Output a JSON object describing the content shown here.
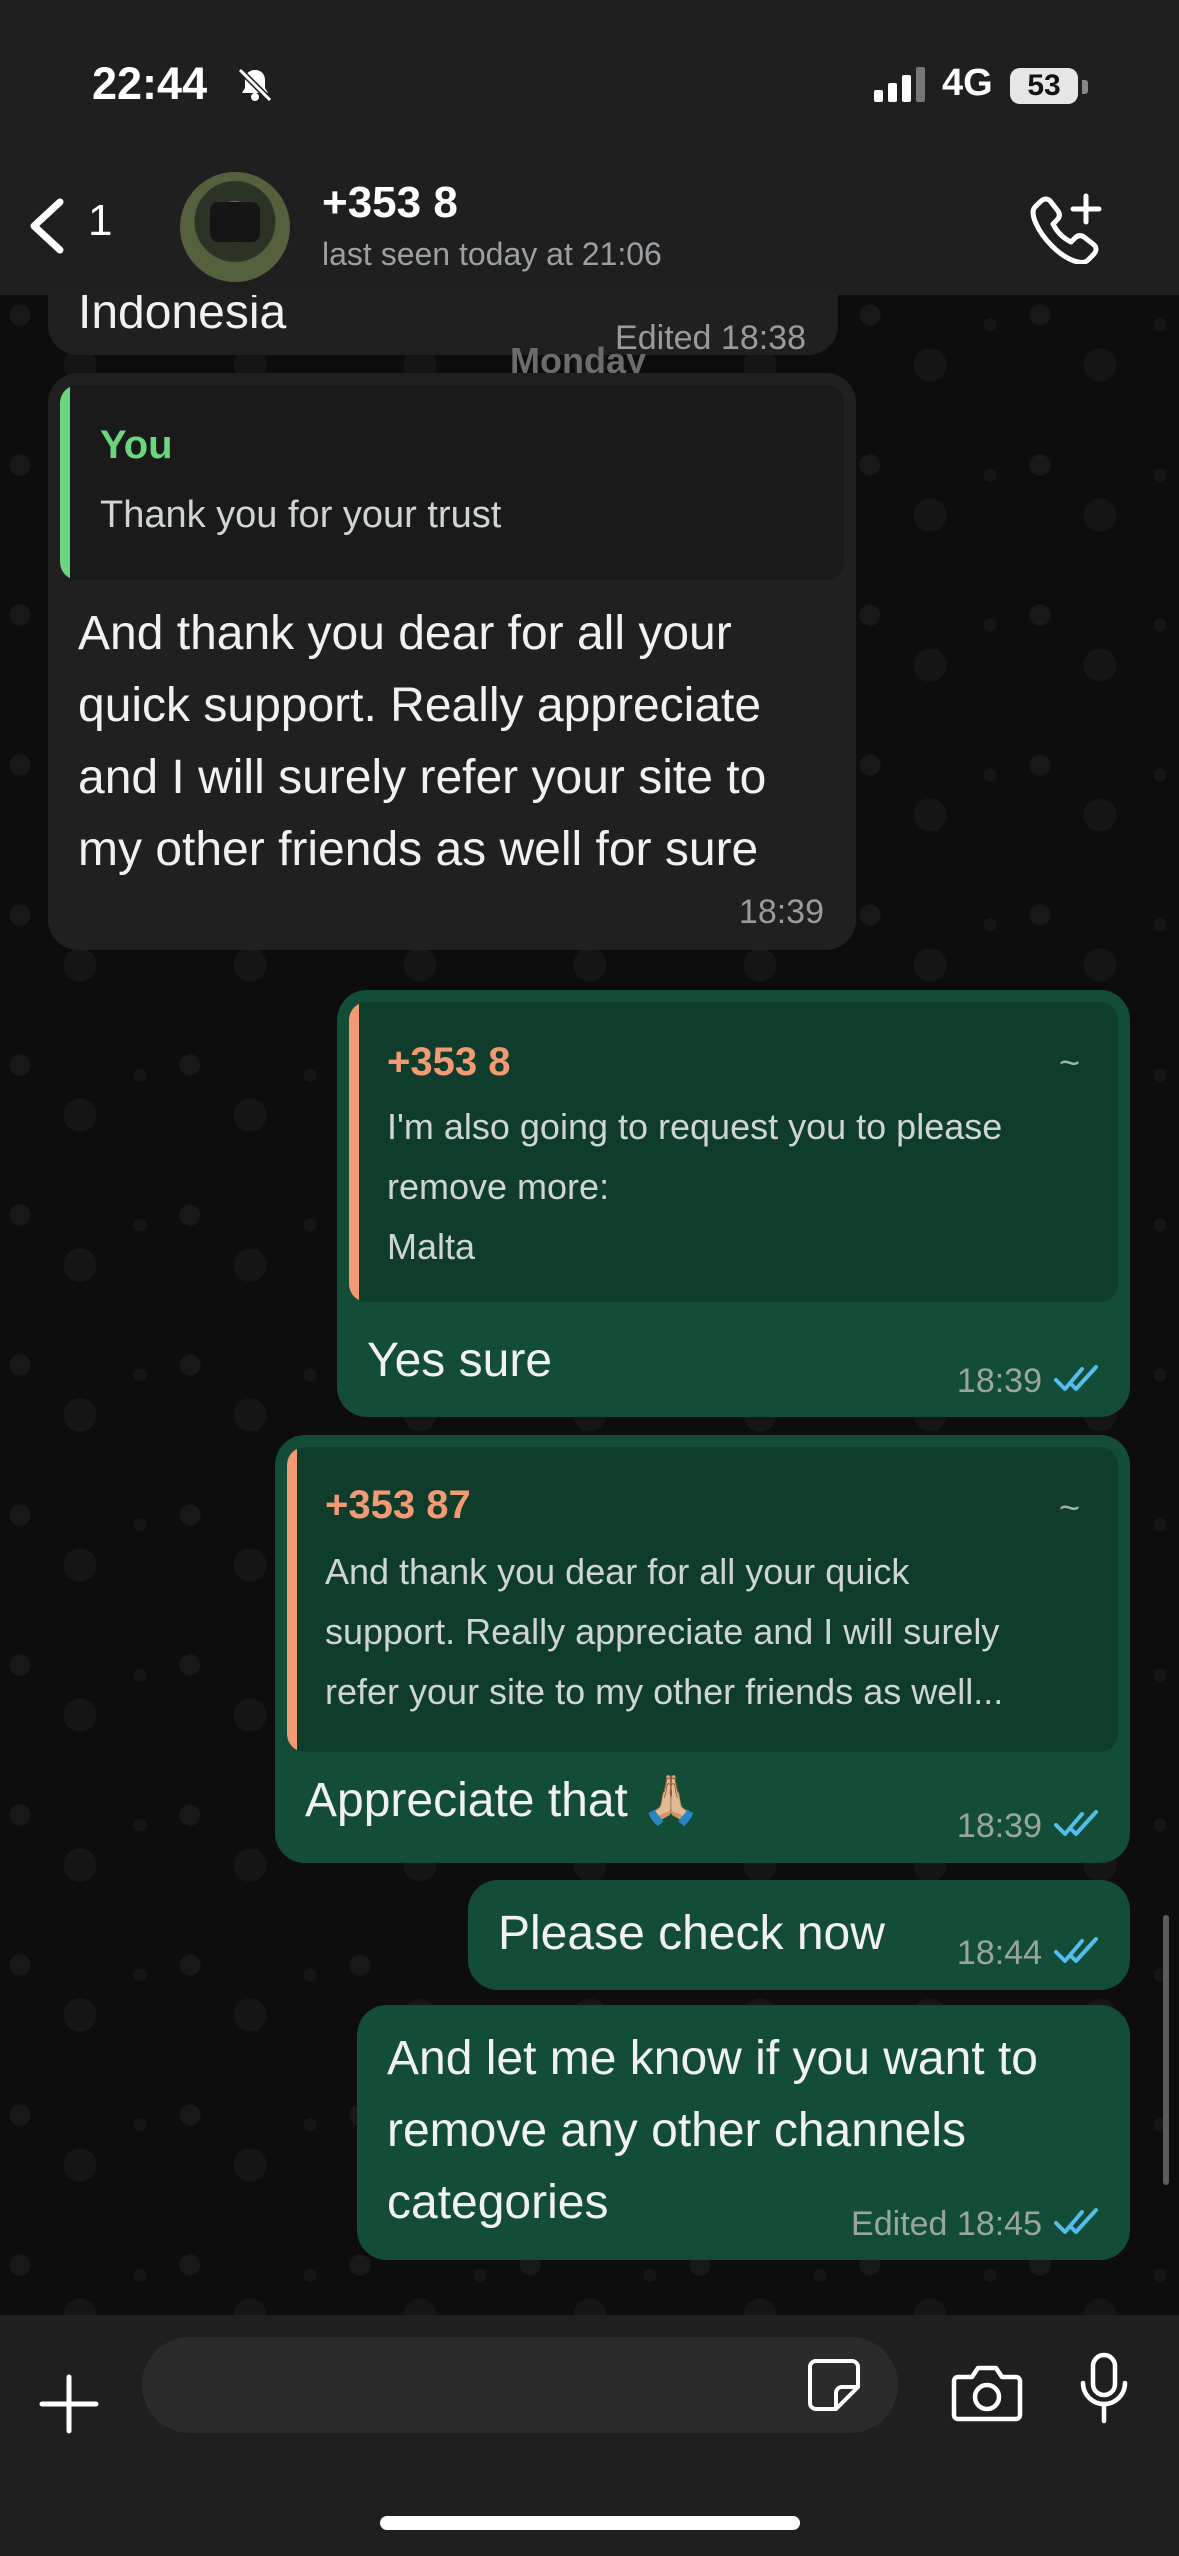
{
  "status_bar": {
    "time": "22:44",
    "network": "4G",
    "battery": "53"
  },
  "header": {
    "back_count": "1",
    "contact_name": "+353 8",
    "last_seen": "last seen today at 21:06"
  },
  "chat": {
    "day_label": "Monday",
    "messages": [
      {
        "direction": "in",
        "text": "Indonesia",
        "status": "Edited",
        "time": "18:38"
      },
      {
        "direction": "in",
        "quote": {
          "author": "You",
          "text": "Thank you for your trust"
        },
        "text": "And thank you dear for all your quick support. Really appreciate and I will surely refer your site to my other friends as well for sure",
        "time": "18:39"
      },
      {
        "direction": "out",
        "quote": {
          "author": "+353 8",
          "tag": "~",
          "text_lines": [
            "I'm also going to request you to please",
            "remove more:",
            "Malta"
          ]
        },
        "text": "Yes sure",
        "time": "18:39"
      },
      {
        "direction": "out",
        "quote": {
          "author": "+353 87",
          "tag": "~",
          "text_lines": [
            "And thank you dear for all your quick",
            "support. Really appreciate and I will surely",
            "refer your site to my other friends as well..."
          ]
        },
        "text": "Appreciate that 🙏🏼",
        "time": "18:39"
      },
      {
        "direction": "out",
        "text": "Please check now",
        "time": "18:44"
      },
      {
        "direction": "out",
        "text_lines": [
          "And let me know if you want to",
          "remove any other channels",
          "categories"
        ],
        "status": "Edited",
        "time": "18:45"
      }
    ]
  },
  "colors": {
    "outgoing_bubble": "#144d37",
    "incoming_bubble": "#202020",
    "quote_you": "#6bd67e",
    "quote_contact": "#f29a74",
    "read_ticks": "#53bdeb"
  },
  "icons": [
    "back-chevron-icon",
    "add-call-icon",
    "plus-icon",
    "sticker-icon",
    "camera-icon",
    "microphone-icon",
    "bell-slash-icon",
    "signal-icon"
  ]
}
